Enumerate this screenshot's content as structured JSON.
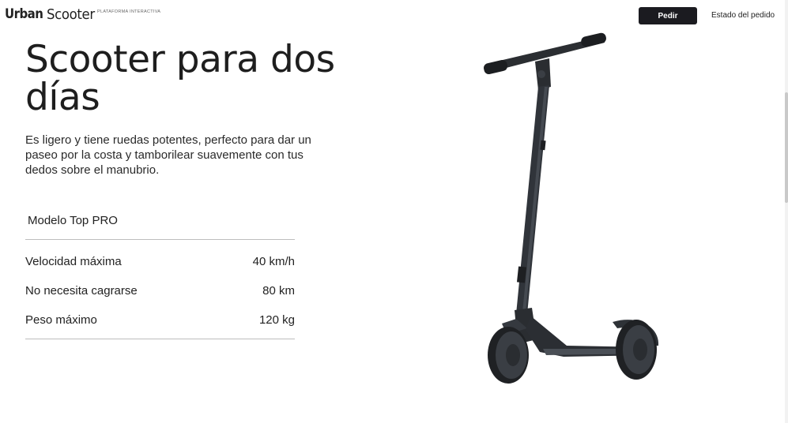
{
  "header": {
    "brand_bold": "Urban",
    "brand_light": "Scooter",
    "brand_tag": "PLATAFORMA INTERACTIVA",
    "order_button": "Pedir",
    "status_link": "Estado del pedido"
  },
  "hero": {
    "title": "Scooter para dos días",
    "description": "Es ligero y tiene ruedas potentes, perfecto para dar un paseo por la costa y tamborilear suavemente con tus dedos sobre el manubrio."
  },
  "specs": {
    "model": "Modelo Top PRO",
    "rows": [
      {
        "label": "Velocidad máxima",
        "value": "40 km/h"
      },
      {
        "label": "No necesita cagrarse",
        "value": "80 km"
      },
      {
        "label": "Peso máximo",
        "value": "120 kg"
      }
    ]
  },
  "product_image": {
    "icon": "electric-scooter-image"
  },
  "colors": {
    "button_bg": "#1b1b20",
    "text": "#1e1e1e",
    "divider": "#bdbdbd"
  }
}
